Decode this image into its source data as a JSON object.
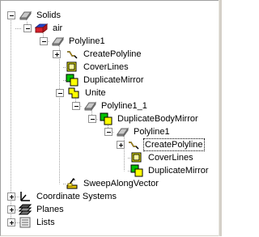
{
  "tree": {
    "solids": "Solids",
    "air": "air",
    "polyline1": "Polyline1",
    "create_polyline": "CreatePolyline",
    "cover_lines": "CoverLines",
    "duplicate_mirror": "DuplicateMirror",
    "unite": "Unite",
    "polyline1_1": "Polyline1_1",
    "duplicate_body_mirror": "DuplicateBodyMirror",
    "polyline1_inner": "Polyline1",
    "create_polyline_inner": "CreatePolyline",
    "cover_lines_inner": "CoverLines",
    "duplicate_mirror_inner": "DuplicateMirror",
    "sweep_along_vector": "SweepAlongVector",
    "coordinate_systems": "Coordinate Systems",
    "planes": "Planes",
    "lists": "Lists"
  },
  "colors": {
    "air_fill": "#d8202c",
    "air_top": "#2244cc",
    "cover_fill": "#ffff00",
    "mirror_green": "#00c000",
    "mirror_yellow": "#ffff00",
    "selection_border": "#000000"
  },
  "icons": {
    "solid": "gray-solid-icon",
    "air": "red-solid-icon",
    "create_polyline": "polyline-icon",
    "cover_lines": "cover-lines-icon",
    "duplicate_mirror": "duplicate-mirror-icon",
    "unite": "unite-icon",
    "sweep": "sweep-icon",
    "coordinate_systems": "axes-icon",
    "planes": "planes-icon",
    "lists": "list-icon"
  }
}
